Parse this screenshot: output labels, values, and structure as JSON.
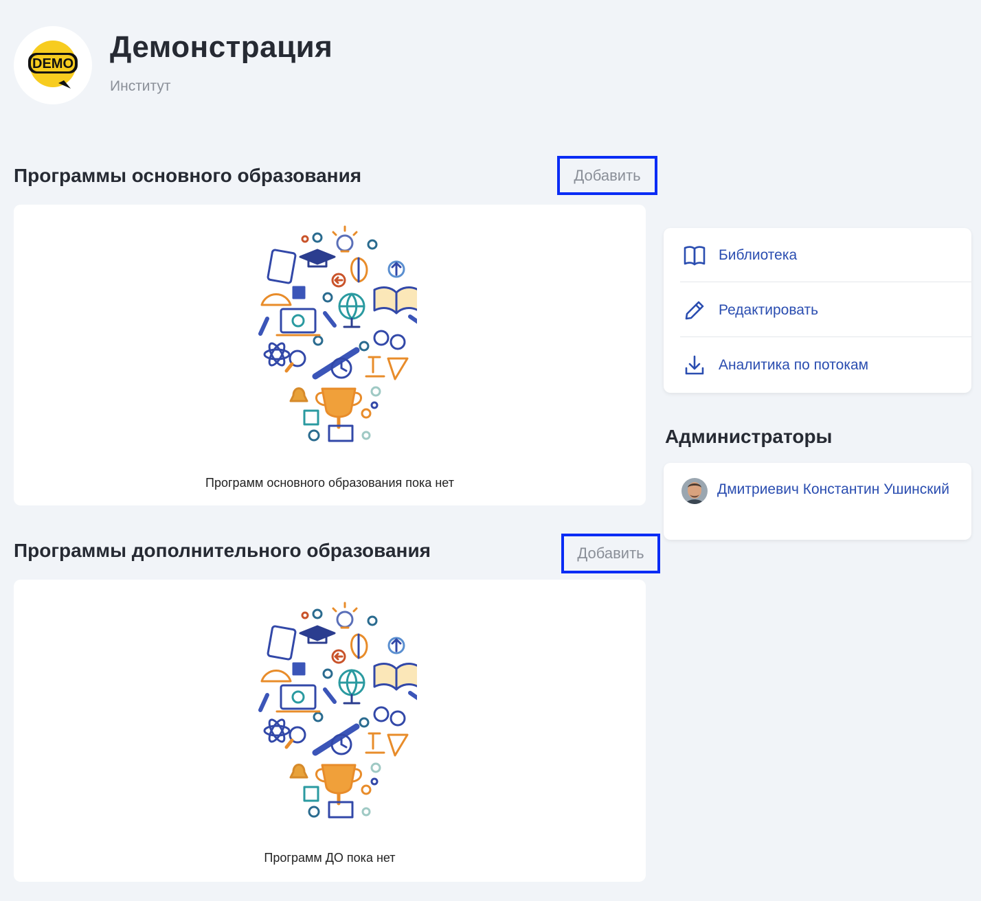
{
  "header": {
    "logo_text": "DEMO",
    "title": "Демонстрация",
    "subtitle": "Институт"
  },
  "sections": {
    "basic": {
      "heading": "Программы основного образования",
      "add_label": "Добавить",
      "empty_text": "Программ основного образования пока нет"
    },
    "additional": {
      "heading": "Программы дополнительного образования",
      "add_label": "Добавить",
      "empty_text": "Программ ДО пока нет"
    }
  },
  "menu": {
    "items": [
      {
        "label": "Библиотека",
        "icon": "book-icon"
      },
      {
        "label": "Редактировать",
        "icon": "pencil-icon"
      },
      {
        "label": "Аналитика по потокам",
        "icon": "download-icon"
      }
    ]
  },
  "admins": {
    "heading": "Администраторы",
    "list": [
      {
        "name": "Дмитриевич Константин Ушинский",
        "avatar": "avatar-photo"
      }
    ]
  },
  "colors": {
    "accent": "#2a4db0",
    "highlight_border": "#0a2cf5",
    "background": "#f1f4f8",
    "logo_yellow": "#f7cc1f"
  }
}
